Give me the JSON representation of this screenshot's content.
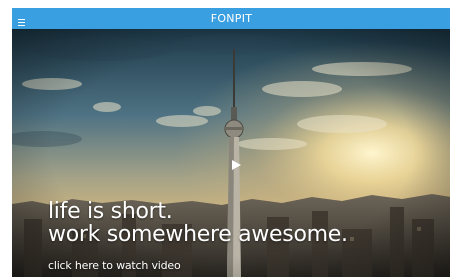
{
  "header": {
    "brand": "FONPIT",
    "menu_icon": "hamburger-menu-icon",
    "background_color": "#3a9fe0"
  },
  "hero": {
    "headline_line1": "life is short.",
    "headline_line2": "work somewhere awesome.",
    "cta_label": "click here to watch video",
    "play_icon": "play-icon",
    "image": "city skyline with tv tower at sunset"
  }
}
